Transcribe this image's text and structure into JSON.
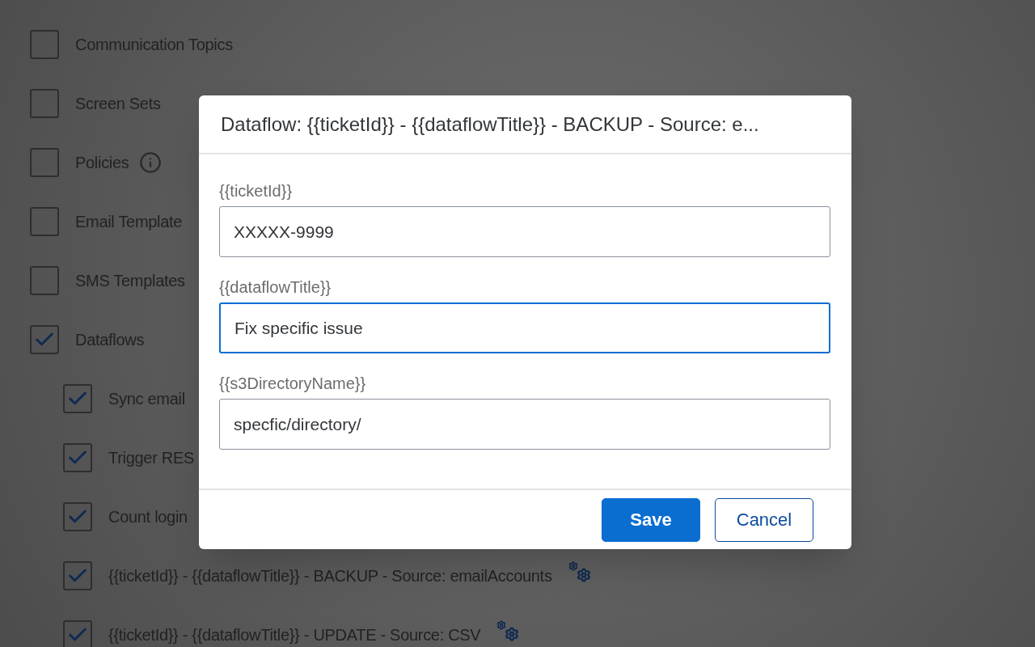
{
  "permissions": [
    {
      "label": "Communication Topics",
      "checked": false
    },
    {
      "label": "Screen Sets",
      "checked": false
    },
    {
      "label": "Policies",
      "checked": false,
      "info": true
    },
    {
      "label": "Email Template",
      "checked": false
    },
    {
      "label": "SMS Templates",
      "checked": false
    },
    {
      "label": "Dataflows",
      "checked": true,
      "children": [
        {
          "label": "Sync email",
          "checked": true
        },
        {
          "label": "Trigger RES",
          "checked": true
        },
        {
          "label": "Count login",
          "checked": true
        },
        {
          "label": "{{ticketId}} - {{dataflowTitle}} - BACKUP - Source: emailAccounts",
          "checked": true,
          "settings": true
        },
        {
          "label": "{{ticketId}} - {{dataflowTitle}} - UPDATE - Source: CSV",
          "checked": true,
          "settings": true
        }
      ]
    }
  ],
  "dialog": {
    "title": "Dataflow: {{ticketId}} - {{dataflowTitle}} - BACKUP - Source: e...",
    "fields": [
      {
        "label": "{{ticketId}}",
        "value": "XXXXX-9999",
        "focused": false
      },
      {
        "label": "{{dataflowTitle}}",
        "value": "Fix specific issue",
        "focused": true
      },
      {
        "label": "{{s3DirectoryName}}",
        "value": "specfic/directory/",
        "focused": false
      }
    ],
    "buttons": [
      {
        "label": "Save",
        "kind": "primary"
      },
      {
        "label": "Cancel",
        "kind": "secondary"
      }
    ]
  }
}
